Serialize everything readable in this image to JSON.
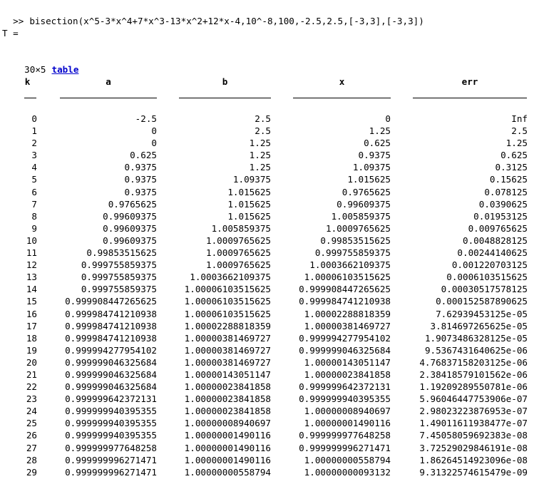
{
  "command": {
    "prompt": ">>",
    "text": "bisection(x^5-3*x^4+7*x^3-13*x^2+12*x-4,10^-8,100,-2.5,2.5,[-3,3],[-3,3])"
  },
  "output": {
    "var_line": "T =",
    "size": "30×5",
    "table_link": "table"
  },
  "table": {
    "headers": [
      "k",
      "a",
      "b",
      "x",
      "err"
    ],
    "rows": [
      [
        "0",
        "-2.5",
        "2.5",
        "0",
        "Inf"
      ],
      [
        "1",
        "0",
        "2.5",
        "1.25",
        "2.5"
      ],
      [
        "2",
        "0",
        "1.25",
        "0.625",
        "1.25"
      ],
      [
        "3",
        "0.625",
        "1.25",
        "0.9375",
        "0.625"
      ],
      [
        "4",
        "0.9375",
        "1.25",
        "1.09375",
        "0.3125"
      ],
      [
        "5",
        "0.9375",
        "1.09375",
        "1.015625",
        "0.15625"
      ],
      [
        "6",
        "0.9375",
        "1.015625",
        "0.9765625",
        "0.078125"
      ],
      [
        "7",
        "0.9765625",
        "1.015625",
        "0.99609375",
        "0.0390625"
      ],
      [
        "8",
        "0.99609375",
        "1.015625",
        "1.005859375",
        "0.01953125"
      ],
      [
        "9",
        "0.99609375",
        "1.005859375",
        "1.0009765625",
        "0.009765625"
      ],
      [
        "10",
        "0.99609375",
        "1.0009765625",
        "0.99853515625",
        "0.0048828125"
      ],
      [
        "11",
        "0.99853515625",
        "1.0009765625",
        "0.999755859375",
        "0.00244140625"
      ],
      [
        "12",
        "0.999755859375",
        "1.0009765625",
        "1.0003662109375",
        "0.001220703125"
      ],
      [
        "13",
        "0.999755859375",
        "1.0003662109375",
        "1.00006103515625",
        "0.0006103515625"
      ],
      [
        "14",
        "0.999755859375",
        "1.00006103515625",
        "0.999908447265625",
        "0.00030517578125"
      ],
      [
        "15",
        "0.999908447265625",
        "1.00006103515625",
        "0.999984741210938",
        "0.000152587890625"
      ],
      [
        "16",
        "0.999984741210938",
        "1.00006103515625",
        "1.00002288818359",
        "7.62939453125e-05"
      ],
      [
        "17",
        "0.999984741210938",
        "1.00002288818359",
        "1.00000381469727",
        "3.814697265625e-05"
      ],
      [
        "18",
        "0.999984741210938",
        "1.00000381469727",
        "0.999994277954102",
        "1.9073486328125e-05"
      ],
      [
        "19",
        "0.999994277954102",
        "1.00000381469727",
        "0.999999046325684",
        "9.5367431640625e-06"
      ],
      [
        "20",
        "0.999999046325684",
        "1.00000381469727",
        "1.00000143051147",
        "4.76837158203125e-06"
      ],
      [
        "21",
        "0.999999046325684",
        "1.00000143051147",
        "1.00000023841858",
        "2.38418579101562e-06"
      ],
      [
        "22",
        "0.999999046325684",
        "1.00000023841858",
        "0.999999642372131",
        "1.19209289550781e-06"
      ],
      [
        "23",
        "0.999999642372131",
        "1.00000023841858",
        "0.999999940395355",
        "5.96046447753906e-07"
      ],
      [
        "24",
        "0.999999940395355",
        "1.00000023841858",
        "1.00000008940697",
        "2.98023223876953e-07"
      ],
      [
        "25",
        "0.999999940395355",
        "1.00000008940697",
        "1.00000001490116",
        "1.49011611938477e-07"
      ],
      [
        "26",
        "0.999999940395355",
        "1.00000001490116",
        "0.999999977648258",
        "7.45058059692383e-08"
      ],
      [
        "27",
        "0.999999977648258",
        "1.00000001490116",
        "0.999999996271471",
        "3.72529029846191e-08"
      ],
      [
        "28",
        "0.999999996271471",
        "1.00000001490116",
        "1.00000000558794",
        "1.86264514923096e-08"
      ],
      [
        "29",
        "0.999999996271471",
        "1.00000000558794",
        "1.00000000093132",
        "9.31322574615479e-09"
      ]
    ]
  }
}
